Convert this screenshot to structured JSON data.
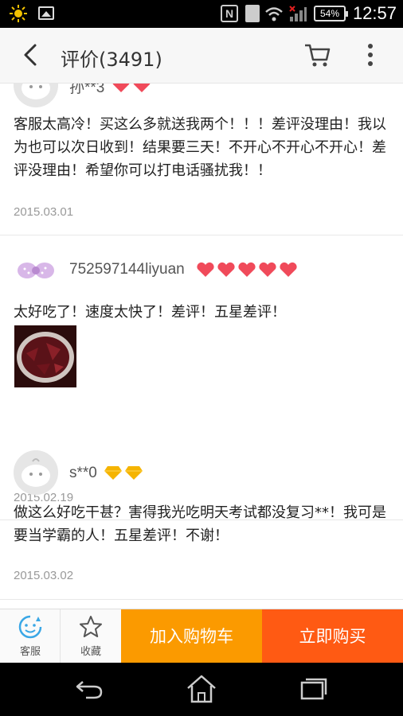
{
  "status_bar": {
    "time": "12:57",
    "battery": "54%"
  },
  "header": {
    "title": "评价(3491)"
  },
  "reviews": [
    {
      "username": "孙**3",
      "badge_icon": "red-heart-badge",
      "badge_count": 2,
      "text": "客服太高冷！买这么多就送我两个！！！差评没理由！我以为也可以次日收到！结果要三天！不开心不开心不开心！差评没理由！希望你可以打电话骚扰我！！",
      "date": "2015.03.01"
    },
    {
      "username": "752597144liyuan",
      "badge_icon": "red-heart-badge",
      "badge_count": 5,
      "text": "太好吃了！速度太快了！差评！五星差评！",
      "has_photo": true,
      "date": "2015.02.19"
    },
    {
      "username": "s**0",
      "badge_icon": "yellow-diamond-badge",
      "badge_count": 2,
      "text": "做这么好吃干甚？害得我光吃明天考试都没复习**！我可是要当学霸的人！五星差评！不谢！",
      "date": "2015.03.02"
    }
  ],
  "action_bar": {
    "service_label": "客服",
    "favorite_label": "收藏",
    "add_to_cart_label": "加入购物车",
    "buy_now_label": "立即购买"
  },
  "colors": {
    "add_to_cart": "#fb9a00",
    "buy_now": "#ff5a13",
    "service_icon": "#3aa7e6",
    "heart_badge": "#f04a5a",
    "diamond_badge": "#f5b400"
  }
}
